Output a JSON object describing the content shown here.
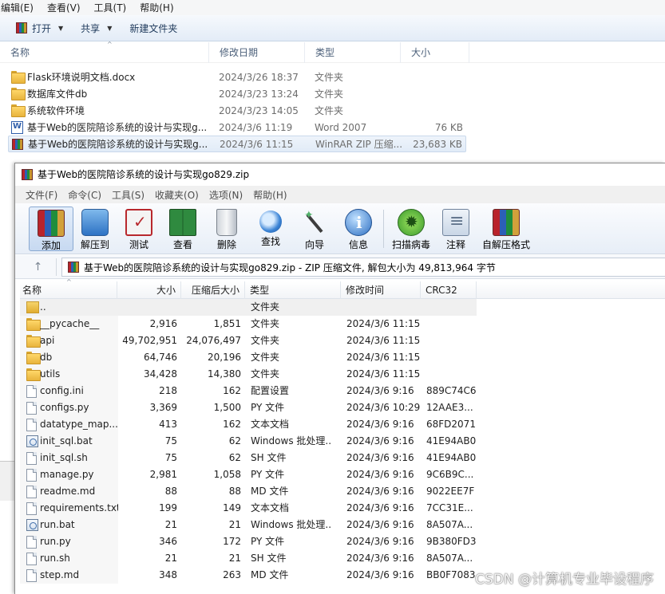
{
  "explorer": {
    "menu": [
      "编辑(E)",
      "查看(V)",
      "工具(T)",
      "帮助(H)"
    ],
    "commands": {
      "open": "打开",
      "share": "共享",
      "new_folder": "新建文件夹"
    },
    "columns": {
      "name": "名称",
      "date": "修改日期",
      "type": "类型",
      "size": "大小"
    },
    "files": [
      {
        "icon": "folder-icon",
        "name": "Flask环境说明文档.docx",
        "date": "2024/3/26 18:37",
        "type": "文件夹",
        "size": ""
      },
      {
        "icon": "folder-icon",
        "name": "数据库文件db",
        "date": "2024/3/23 13:24",
        "type": "文件夹",
        "size": ""
      },
      {
        "icon": "folder-icon",
        "name": "系统软件环境",
        "date": "2024/3/23 14:05",
        "type": "文件夹",
        "size": ""
      },
      {
        "icon": "word-doc-icon",
        "name": "基于Web的医院陪诊系统的设计与实现g...",
        "date": "2024/3/6 11:19",
        "type": "Word 2007",
        "size": "76 KB"
      },
      {
        "icon": "rar-archive-icon",
        "name": "基于Web的医院陪诊系统的设计与实现g...",
        "date": "2024/3/6 11:15",
        "type": "WinRAR ZIP 压缩...",
        "size": "23,683 KB"
      }
    ]
  },
  "winrar": {
    "title": "基于Web的医院陪诊系统的设计与实现go829.zip",
    "menu": [
      "文件(F)",
      "命令(C)",
      "工具(S)",
      "收藏夹(O)",
      "选项(N)",
      "帮助(H)"
    ],
    "toolbar": {
      "add": "添加",
      "extract": "解压到",
      "test": "测试",
      "view": "查看",
      "delete": "删除",
      "find": "查找",
      "wizard": "向导",
      "info": "信息",
      "virus": "扫描病毒",
      "comment": "注释",
      "sfx": "自解压格式"
    },
    "up_arrow": "↑",
    "path": "基于Web的医院陪诊系统的设计与实现go829.zip - ZIP 压缩文件, 解包大小为 49,813,964 字节",
    "columns": {
      "name": "名称",
      "size": "大小",
      "packed": "压缩后大小",
      "type": "类型",
      "modified": "修改时间",
      "crc": "CRC32"
    },
    "rows": [
      {
        "icon": "parent-folder-icon",
        "name": "..",
        "size": "",
        "packed": "",
        "type": "文件夹",
        "modified": "",
        "crc": ""
      },
      {
        "icon": "folder-icon",
        "name": "__pycache__",
        "size": "2,916",
        "packed": "1,851",
        "type": "文件夹",
        "modified": "2024/3/6 11:15",
        "crc": ""
      },
      {
        "icon": "folder-icon",
        "name": "api",
        "size": "49,702,951",
        "packed": "24,076,497",
        "type": "文件夹",
        "modified": "2024/3/6 11:15",
        "crc": ""
      },
      {
        "icon": "folder-icon",
        "name": "db",
        "size": "64,746",
        "packed": "20,196",
        "type": "文件夹",
        "modified": "2024/3/6 11:15",
        "crc": ""
      },
      {
        "icon": "folder-icon",
        "name": "utils",
        "size": "34,428",
        "packed": "14,380",
        "type": "文件夹",
        "modified": "2024/3/6 11:15",
        "crc": ""
      },
      {
        "icon": "config-file-icon",
        "name": "config.ini",
        "size": "218",
        "packed": "162",
        "type": "配置设置",
        "modified": "2024/3/6 9:16",
        "crc": "889C74C6"
      },
      {
        "icon": "document-icon",
        "name": "configs.py",
        "size": "3,369",
        "packed": "1,500",
        "type": "PY 文件",
        "modified": "2024/3/6 10:29",
        "crc": "12AAE3..."
      },
      {
        "icon": "document-icon",
        "name": "datatype_map....",
        "size": "413",
        "packed": "162",
        "type": "文本文档",
        "modified": "2024/3/6 9:16",
        "crc": "68FD2071"
      },
      {
        "icon": "batch-file-icon",
        "name": "init_sql.bat",
        "size": "75",
        "packed": "62",
        "type": "Windows 批处理...",
        "modified": "2024/3/6 9:16",
        "crc": "41E94AB0"
      },
      {
        "icon": "document-icon",
        "name": "init_sql.sh",
        "size": "75",
        "packed": "62",
        "type": "SH 文件",
        "modified": "2024/3/6 9:16",
        "crc": "41E94AB0"
      },
      {
        "icon": "document-icon",
        "name": "manage.py",
        "size": "2,981",
        "packed": "1,058",
        "type": "PY 文件",
        "modified": "2024/3/6 9:16",
        "crc": "9C6B9C..."
      },
      {
        "icon": "document-icon",
        "name": "readme.md",
        "size": "88",
        "packed": "88",
        "type": "MD 文件",
        "modified": "2024/3/6 9:16",
        "crc": "9022EE7F"
      },
      {
        "icon": "document-icon",
        "name": "requirements.txt",
        "size": "199",
        "packed": "149",
        "type": "文本文档",
        "modified": "2024/3/6 9:16",
        "crc": "7CC31E..."
      },
      {
        "icon": "batch-file-icon",
        "name": "run.bat",
        "size": "21",
        "packed": "21",
        "type": "Windows 批处理...",
        "modified": "2024/3/6 9:16",
        "crc": "8A507A..."
      },
      {
        "icon": "document-icon",
        "name": "run.py",
        "size": "346",
        "packed": "172",
        "type": "PY 文件",
        "modified": "2024/3/6 9:16",
        "crc": "9B380FD3"
      },
      {
        "icon": "document-icon",
        "name": "run.sh",
        "size": "21",
        "packed": "21",
        "type": "SH 文件",
        "modified": "2024/3/6 9:16",
        "crc": "8A507A..."
      },
      {
        "icon": "document-icon",
        "name": "step.md",
        "size": "348",
        "packed": "263",
        "type": "MD 文件",
        "modified": "2024/3/6 9:16",
        "crc": "BB0F7083"
      }
    ]
  },
  "watermark": "CSDN @计算机专业毕设程序"
}
